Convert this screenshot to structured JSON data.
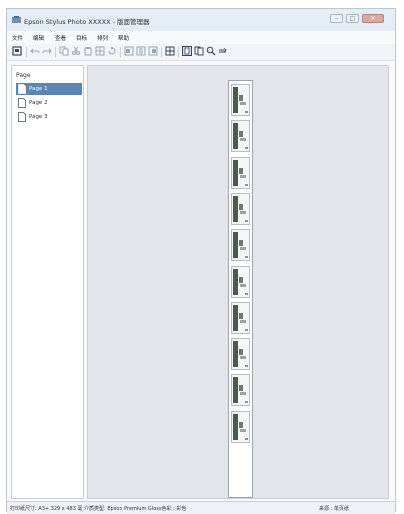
{
  "window": {
    "title": "Epson Stylus Photo XXXXX - 版面管理器"
  },
  "menu": [
    "文件",
    "编辑",
    "查看",
    "目标",
    "排列",
    "帮助"
  ],
  "sidebar": {
    "title": "Page",
    "pages": [
      {
        "label": "Page 1",
        "selected": true
      },
      {
        "label": "Page 2",
        "selected": false
      },
      {
        "label": "Page 3",
        "selected": false
      }
    ]
  },
  "canvas": {
    "thumbnail_count": 10
  },
  "status": {
    "left": "打印纸尺寸: A3+ 329 x 483 毫 介质类型: Epson Premium Gloss色彩 : 彩色",
    "right": "来源 : 单页纸"
  },
  "colors": {
    "selection": "#5a86b6",
    "canvas_bg": "#e3e6e8",
    "thumb_accent": "#4d5b4f"
  },
  "icons": [
    "layout-icon",
    "undo-icon",
    "redo-icon",
    "copy-icon",
    "cut-icon",
    "paste-icon",
    "duplicate-icon",
    "rotate-icon",
    "align-left-icon",
    "align-center-icon",
    "align-right-icon",
    "grid-icon",
    "single-page-icon",
    "multi-page-icon",
    "zoom-icon",
    "settings-icon"
  ]
}
